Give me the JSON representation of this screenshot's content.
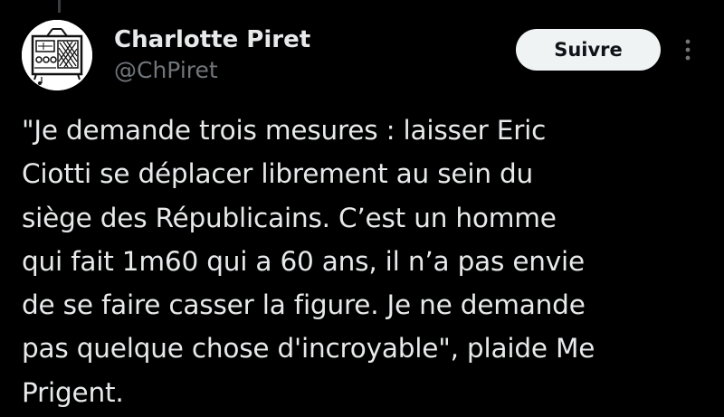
{
  "author": {
    "display_name": "Charlotte Piret",
    "handle": "@ChPiret",
    "avatar_icon": "radio-sketch-icon"
  },
  "actions": {
    "follow_label": "Suivre",
    "more_icon": "more-vertical-icon"
  },
  "tweet": {
    "text": "\"Je demande trois mesures : laisser Eric\nCiotti se déplacer librement au sein du\nsiège des Républicains. C’est un homme\nqui fait 1m60 qui a 60 ans, il n’a pas envie\nde se faire casser la figure. Je ne demande\npas quelque chose d'incroyable\", plaide Me\nPrigent."
  },
  "colors": {
    "background": "#000000",
    "text_primary": "#e7e9ea",
    "text_secondary": "#71767b",
    "follow_button_bg": "#eff3f4",
    "follow_button_text": "#0f1419"
  }
}
